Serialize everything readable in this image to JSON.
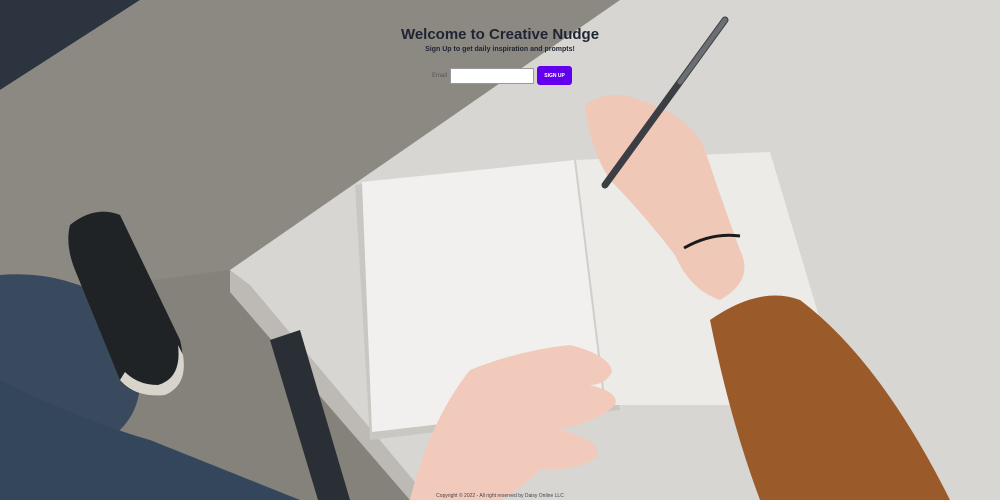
{
  "hero": {
    "title": "Welcome to Creative Nudge",
    "subtitle": "Sign Up to get daily inspiration and prompts!"
  },
  "signup": {
    "email_label": "Email",
    "email_value": "",
    "email_placeholder": "",
    "submit_label": "SIGN UP"
  },
  "footer": {
    "copyright": "Copyright © 2022 - All right reserved by Daisy Online LLC"
  },
  "colors": {
    "accent": "#6200ee",
    "title_text": "#1f2433"
  },
  "background": {
    "description_icon": "notebook-writing-photo"
  }
}
